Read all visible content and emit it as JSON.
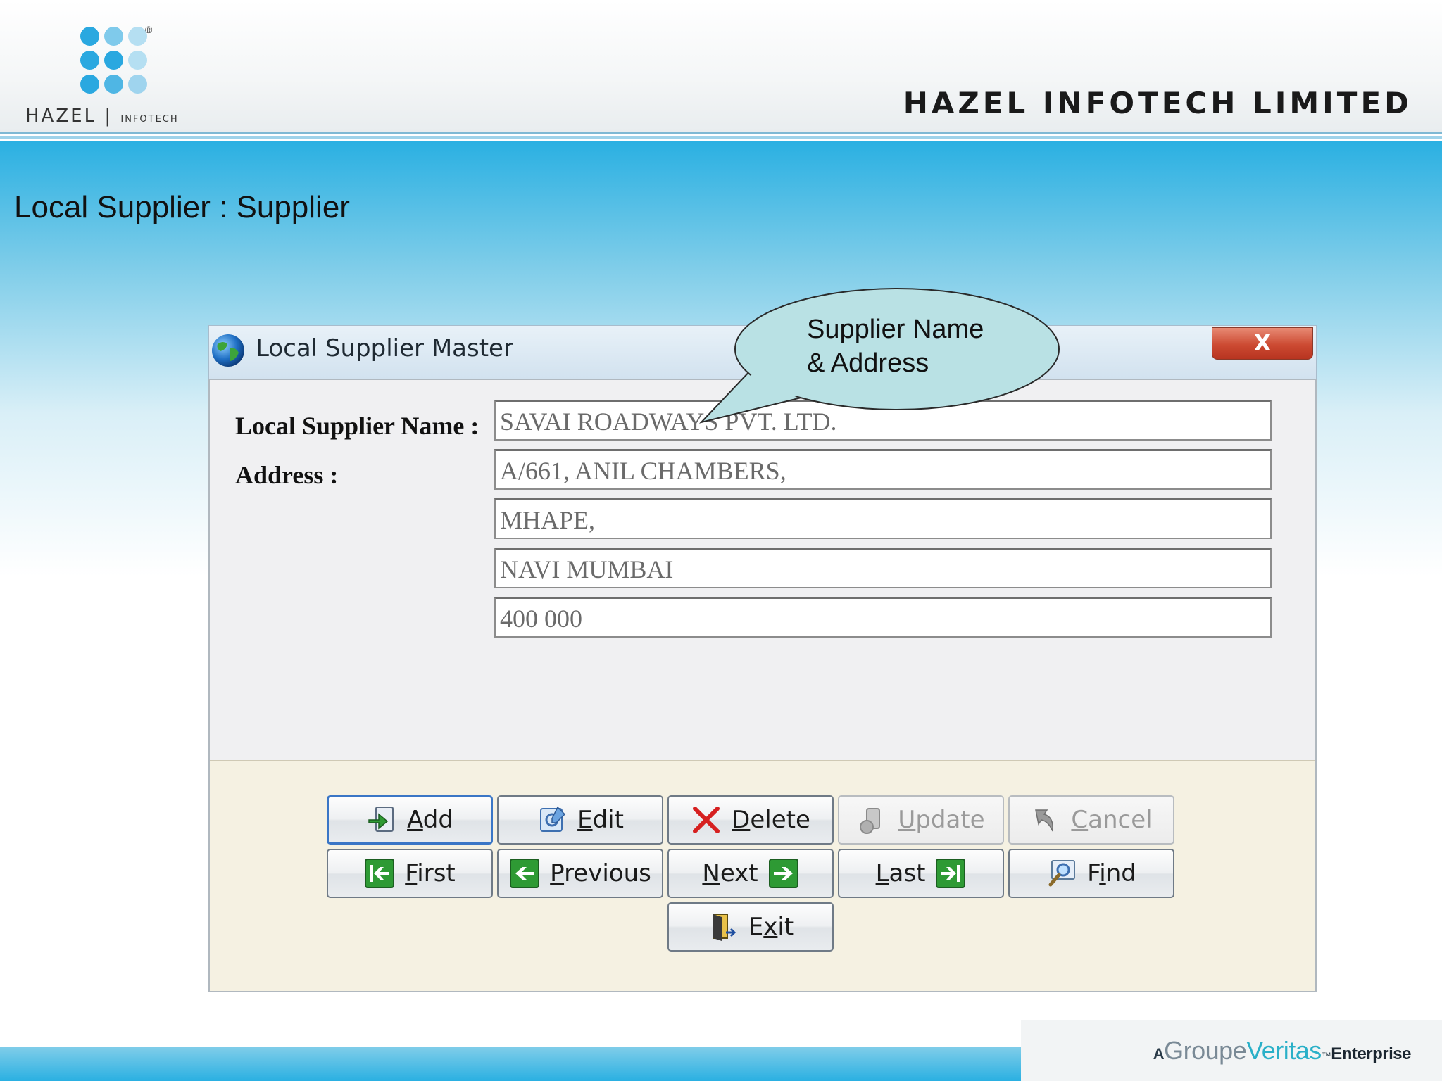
{
  "header": {
    "logo_text": "HAZEL",
    "logo_sub": "INFOTECH",
    "logo_reg": "®",
    "company": "HAZEL INFOTECH LIMITED"
  },
  "slide_title": "Local Supplier : Supplier",
  "window": {
    "title": "Local Supplier Master",
    "close_label": "X"
  },
  "form": {
    "name_label": "Local Supplier Name :",
    "address_label": "Address :",
    "name_value": "SAVAI ROADWAYS PVT. LTD.",
    "address_lines": [
      "A/661, ANIL CHAMBERS,",
      "MHAPE,",
      "NAVI MUMBAI",
      "400 000"
    ]
  },
  "callout": {
    "line1": "Supplier Name",
    "line2": "& Address"
  },
  "buttons": {
    "add": "dd",
    "add_u": "A",
    "edit": "dit",
    "edit_u": "E",
    "delete": "elete",
    "delete_u": "D",
    "update": "pdate",
    "update_u": "U",
    "cancel": "ancel",
    "cancel_u": "C",
    "first": "irst",
    "first_u": "F",
    "previous": "revious",
    "previous_u": "P",
    "next": "ext",
    "next_u": "N",
    "last": "ast",
    "last_u": "L",
    "find": "F",
    "find_u": "i",
    "find_rest": "nd",
    "exit": "E",
    "exit_u": "x",
    "exit_rest": "it"
  },
  "footer": {
    "a": "A",
    "groupe": "Groupe",
    "veritas": "Veritas",
    "tm": "™",
    "enterprise": "Enterprise"
  },
  "colors": {
    "accent_blue": "#2ab0e2",
    "close_red": "#cc4a32",
    "callout_fill": "#b9e1e4",
    "button_area": "#f5f1e2"
  }
}
